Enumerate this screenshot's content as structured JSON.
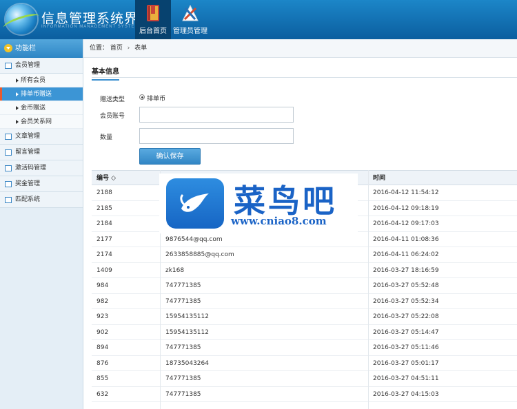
{
  "header": {
    "title": "信息管理系统界面",
    "subtitle": "INFORMATION MANAGEMENT SYSTEM GUI",
    "tabs": [
      {
        "label": "后台首页",
        "icon": "book-icon",
        "active": true
      },
      {
        "label": "管理员管理",
        "icon": "tools-icon",
        "active": false
      }
    ]
  },
  "sidebar": {
    "heading": "功能栏",
    "groups": [
      {
        "label": "会员管理",
        "icon": "member-icon"
      },
      {
        "label": "文章管理",
        "icon": "article-icon"
      },
      {
        "label": "留言管理",
        "icon": "message-icon"
      },
      {
        "label": "激活码管理",
        "icon": "key-icon"
      },
      {
        "label": "奖金管理",
        "icon": "bonus-icon"
      },
      {
        "label": "匹配系统",
        "icon": "match-icon"
      }
    ],
    "member_items": [
      {
        "label": "所有会员"
      },
      {
        "label": "排单币赠送",
        "active": true
      },
      {
        "label": "金币赠送"
      },
      {
        "label": "会员关系网"
      }
    ]
  },
  "breadcrumb": {
    "prefix": "位置：",
    "home": "首页",
    "sep": "›",
    "current": "表单"
  },
  "form": {
    "section_title": "基本信息",
    "type_label": "赠送类型",
    "type_option": "排单币",
    "account_label": "会员账号",
    "account_value": "",
    "quantity_label": "数量",
    "quantity_value": "",
    "save_label": "确认保存"
  },
  "table": {
    "headers": [
      "编号 ◇",
      "",
      "时间"
    ],
    "rows": [
      [
        "2188",
        "",
        "2016-04-12 11:54:12"
      ],
      [
        "2185",
        "",
        "2016-04-12 09:18:19"
      ],
      [
        "2184",
        "",
        "2016-04-12 09:17:03"
      ],
      [
        "2177",
        "9876544@qq.com",
        "2016-04-11 01:08:36"
      ],
      [
        "2174",
        "2633858885@qq.com",
        "2016-04-11 06:24:02"
      ],
      [
        "1409",
        "zk168",
        "2016-03-27 18:16:59"
      ],
      [
        "984",
        "747771385",
        "2016-03-27 05:52:48"
      ],
      [
        "982",
        "747771385",
        "2016-03-27 05:52:34"
      ],
      [
        "923",
        "15954135112",
        "2016-03-27 05:22:08"
      ],
      [
        "902",
        "15954135112",
        "2016-03-27 05:14:47"
      ],
      [
        "894",
        "747771385",
        "2016-03-27 05:11:46"
      ],
      [
        "876",
        "18735043264",
        "2016-03-27 05:01:17"
      ],
      [
        "855",
        "747771385",
        "2016-03-27 04:51:11"
      ],
      [
        "632",
        "747771385",
        "2016-03-27 04:15:03"
      ]
    ]
  },
  "watermark": {
    "brand": "菜鸟吧",
    "url": "www.cniao8.com"
  },
  "colors": {
    "header": "#0b5e9f",
    "accent": "#3a8fd0",
    "watermark": "#1a63c6"
  }
}
